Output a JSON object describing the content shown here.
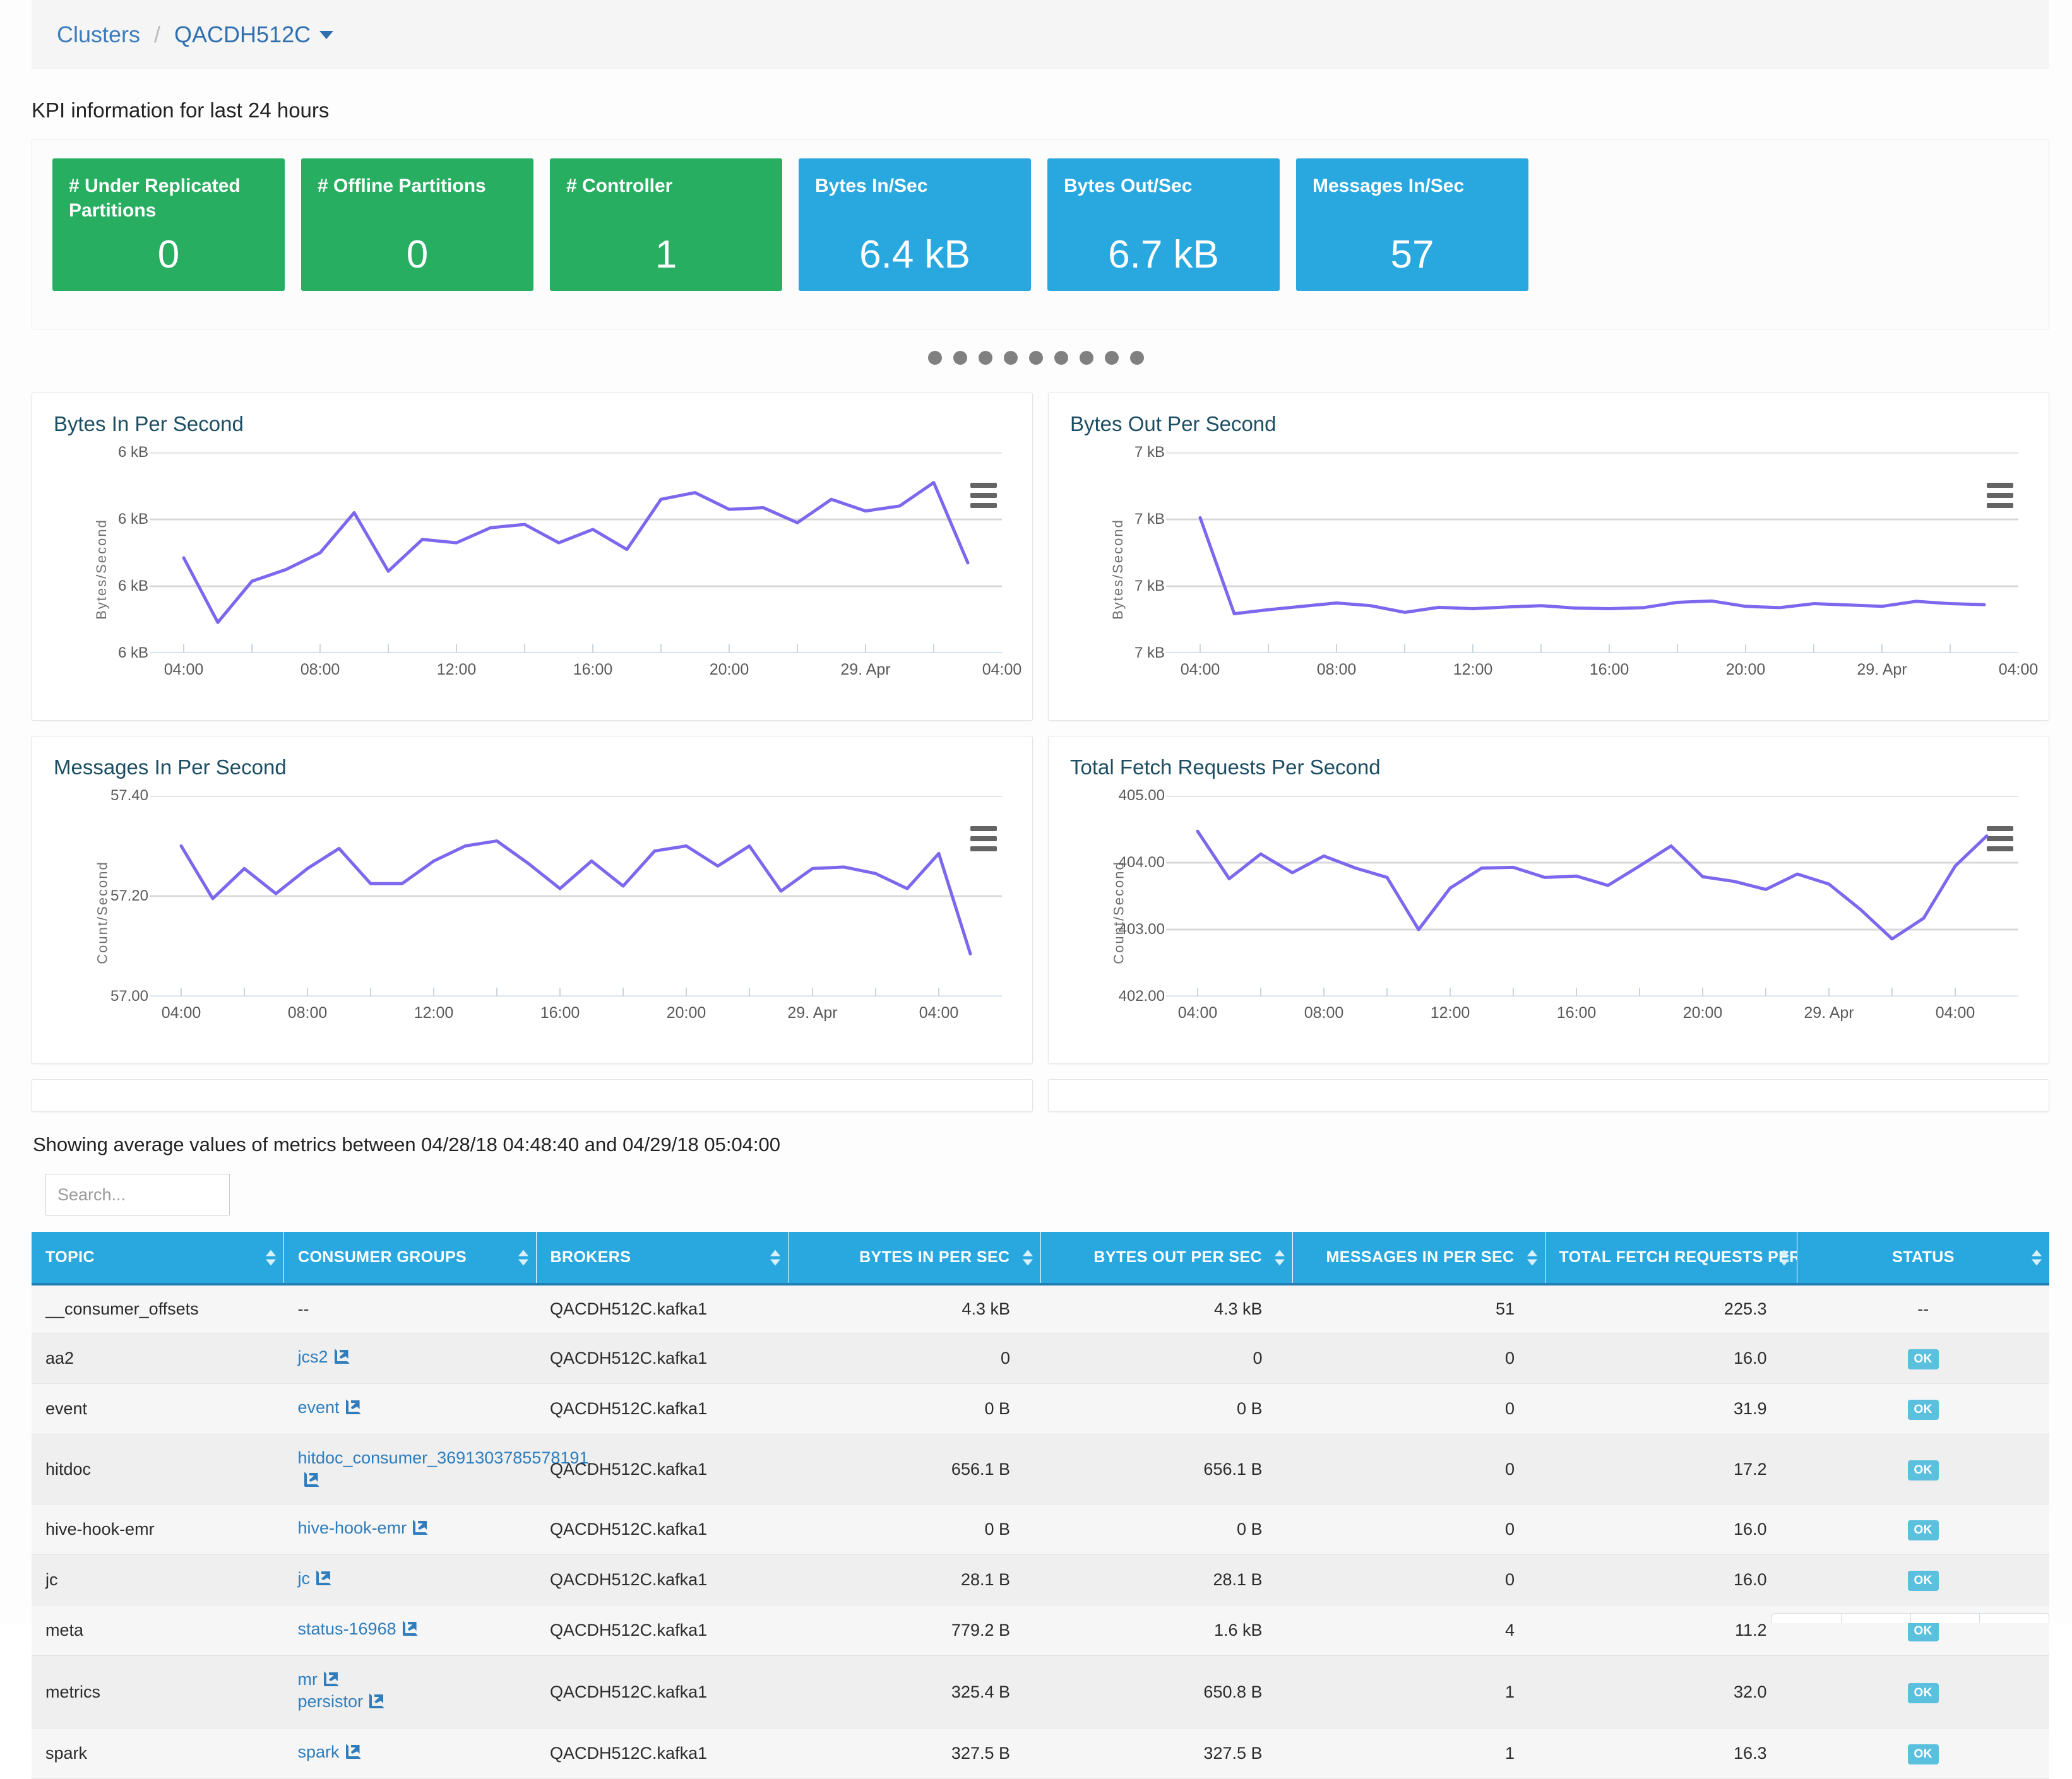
{
  "breadcrumb": {
    "root": "Clusters",
    "separator": "/",
    "current": "QACDH512C"
  },
  "kpi": {
    "heading": "KPI information for last 24 hours",
    "cards": [
      {
        "label": "# Under Replicated Partitions",
        "value": "0",
        "color": "#27ae60",
        "tone": "green"
      },
      {
        "label": "# Offline Partitions",
        "value": "0",
        "color": "#27ae60",
        "tone": "green"
      },
      {
        "label": "# Controller",
        "value": "1",
        "color": "#27ae60",
        "tone": "green"
      },
      {
        "label": "Bytes In/Sec",
        "value": "6.4 kB",
        "color": "#29a8e0",
        "tone": "blue"
      },
      {
        "label": "Bytes Out/Sec",
        "value": "6.7 kB",
        "color": "#29a8e0",
        "tone": "blue"
      },
      {
        "label": "Messages In/Sec",
        "value": "57",
        "color": "#29a8e0",
        "tone": "blue"
      }
    ],
    "carousel_dots": 9
  },
  "chart_data": [
    {
      "type": "line",
      "title": "Bytes In Per Second",
      "ylabel": "Bytes/Second",
      "xlabel": "",
      "yticks": [
        "6 kB",
        "6 kB",
        "6 kB",
        "6 kB"
      ],
      "ylim": [
        6000,
        6600
      ],
      "ytick_values": [
        6600,
        6400,
        6200,
        6000
      ],
      "xticks": [
        "04:00",
        "08:00",
        "12:00",
        "16:00",
        "20:00",
        "29. Apr",
        "04:00"
      ],
      "grid": true,
      "legend": "none",
      "color": "#7b68ee",
      "x": [
        0,
        1,
        2,
        3,
        4,
        5,
        6,
        7,
        8,
        9,
        10,
        11,
        12,
        13,
        14,
        15,
        16,
        17,
        18,
        19,
        20,
        21,
        22,
        23,
        24,
        25
      ],
      "values": [
        6285,
        6092,
        6215,
        6250,
        6300,
        6420,
        6245,
        6340,
        6330,
        6375,
        6385,
        6330,
        6370,
        6310,
        6460,
        6480,
        6430,
        6435,
        6390,
        6460,
        6425,
        6440,
        6510,
        6270
      ]
    },
    {
      "type": "line",
      "title": "Bytes Out Per Second",
      "ylabel": "Bytes/Second",
      "xlabel": "",
      "yticks": [
        "7 kB",
        "7 kB",
        "7 kB",
        "7 kB"
      ],
      "ylim": [
        6600,
        7200
      ],
      "ytick_values": [
        7200,
        7000,
        6800,
        6600
      ],
      "xticks": [
        "04:00",
        "08:00",
        "12:00",
        "16:00",
        "20:00",
        "29. Apr",
        "04:00"
      ],
      "grid": true,
      "legend": "none",
      "color": "#7b68ee",
      "x": [
        0,
        1,
        2,
        3,
        4,
        5,
        6,
        7,
        8,
        9,
        10,
        11,
        12,
        13,
        14,
        15,
        16,
        17,
        18,
        19,
        20,
        21,
        22,
        23
      ],
      "values": [
        7005,
        6718,
        6730,
        6740,
        6750,
        6742,
        6722,
        6737,
        6733,
        6738,
        6742,
        6735,
        6733,
        6736,
        6752,
        6756,
        6740,
        6736,
        6748,
        6744,
        6740,
        6755,
        6748,
        6745
      ]
    },
    {
      "type": "line",
      "title": "Messages In Per Second",
      "ylabel": "Count/Second",
      "xlabel": "",
      "yticks": [
        "57.40",
        "57.20",
        "57.00"
      ],
      "ylim": [
        57.0,
        57.4
      ],
      "ytick_values": [
        57.4,
        57.2,
        57.0
      ],
      "xticks": [
        "04:00",
        "08:00",
        "12:00",
        "16:00",
        "20:00",
        "29. Apr",
        "04:00"
      ],
      "grid": true,
      "legend": "none",
      "color": "#7b68ee",
      "x": [
        0,
        1,
        2,
        3,
        4,
        5,
        6,
        7,
        8,
        9,
        10,
        11,
        12,
        13,
        14,
        15,
        16,
        17,
        18,
        19,
        20,
        21,
        22,
        23,
        24,
        25
      ],
      "values": [
        57.3,
        57.195,
        57.255,
        57.205,
        57.255,
        57.295,
        57.225,
        57.225,
        57.27,
        57.3,
        57.31,
        57.265,
        57.215,
        57.27,
        57.22,
        57.29,
        57.3,
        57.26,
        57.3,
        57.21,
        57.255,
        57.258,
        57.245,
        57.215,
        57.285,
        57.085
      ]
    },
    {
      "type": "line",
      "title": "Total Fetch Requests Per Second",
      "ylabel": "Count/Second",
      "xlabel": "",
      "yticks": [
        "405.00",
        "404.00",
        "403.00",
        "402.00"
      ],
      "ylim": [
        402.0,
        405.0
      ],
      "ytick_values": [
        405.0,
        404.0,
        403.0,
        402.0
      ],
      "xticks": [
        "04:00",
        "08:00",
        "12:00",
        "16:00",
        "20:00",
        "29. Apr",
        "04:00"
      ],
      "grid": true,
      "legend": "none",
      "color": "#7b68ee",
      "x": [
        0,
        1,
        2,
        3,
        4,
        5,
        6,
        7,
        8,
        9,
        10,
        11,
        12,
        13,
        14,
        15,
        16,
        17,
        18,
        19,
        20,
        21,
        22,
        23,
        24,
        25
      ],
      "values": [
        404.47,
        403.76,
        404.13,
        403.85,
        404.1,
        403.92,
        403.78,
        403.0,
        403.62,
        403.92,
        403.93,
        403.78,
        403.8,
        403.66,
        403.95,
        404.25,
        403.79,
        403.72,
        403.6,
        403.83,
        403.68,
        403.3,
        402.86,
        403.17,
        403.95,
        404.4
      ]
    }
  ],
  "metrics_note": "Showing average values of metrics between 04/28/18 04:48:40 and 04/29/18 05:04:00",
  "search": {
    "placeholder": "Search...",
    "value": ""
  },
  "table": {
    "columns": [
      {
        "label": "TOPIC",
        "align": "left",
        "sortable": true
      },
      {
        "label": "CONSUMER GROUPS",
        "align": "left",
        "sortable": true
      },
      {
        "label": "BROKERS",
        "align": "left",
        "sortable": true
      },
      {
        "label": "BYTES IN PER SEC",
        "align": "right",
        "sortable": true
      },
      {
        "label": "BYTES OUT PER SEC",
        "align": "right",
        "sortable": true
      },
      {
        "label": "MESSAGES IN PER SEC",
        "align": "right",
        "sortable": true
      },
      {
        "label": "TOTAL FETCH REQUESTS PER SEC",
        "align": "right",
        "sortable": true
      },
      {
        "label": "STATUS",
        "align": "center",
        "sortable": true
      }
    ],
    "rows": [
      {
        "topic": "__consumer_offsets",
        "consumer_groups": [
          "--"
        ],
        "groups_are_links": false,
        "brokers": "QACDH512C.kafka1",
        "bytes_in": "4.3 kB",
        "bytes_out": "4.3 kB",
        "messages_in": "51",
        "fetch_requests": "225.3",
        "status": "--"
      },
      {
        "topic": "aa2",
        "consumer_groups": [
          "jcs2"
        ],
        "groups_are_links": true,
        "brokers": "QACDH512C.kafka1",
        "bytes_in": "0",
        "bytes_out": "0",
        "messages_in": "0",
        "fetch_requests": "16.0",
        "status": "OK"
      },
      {
        "topic": "event",
        "consumer_groups": [
          "event"
        ],
        "groups_are_links": true,
        "brokers": "QACDH512C.kafka1",
        "bytes_in": "0 B",
        "bytes_out": "0 B",
        "messages_in": "0",
        "fetch_requests": "31.9",
        "status": "OK"
      },
      {
        "topic": "hitdoc",
        "consumer_groups": [
          "hitdoc_consumer_3691303785578191"
        ],
        "groups_are_links": true,
        "brokers": "QACDH512C.kafka1",
        "bytes_in": "656.1 B",
        "bytes_out": "656.1 B",
        "messages_in": "0",
        "fetch_requests": "17.2",
        "status": "OK"
      },
      {
        "topic": "hive-hook-emr",
        "consumer_groups": [
          "hive-hook-emr"
        ],
        "groups_are_links": true,
        "brokers": "QACDH512C.kafka1",
        "bytes_in": "0 B",
        "bytes_out": "0 B",
        "messages_in": "0",
        "fetch_requests": "16.0",
        "status": "OK"
      },
      {
        "topic": "jc",
        "consumer_groups": [
          "jc"
        ],
        "groups_are_links": true,
        "brokers": "QACDH512C.kafka1",
        "bytes_in": "28.1 B",
        "bytes_out": "28.1 B",
        "messages_in": "0",
        "fetch_requests": "16.0",
        "status": "OK"
      },
      {
        "topic": "meta",
        "consumer_groups": [
          "status-16968"
        ],
        "groups_are_links": true,
        "brokers": "QACDH512C.kafka1",
        "bytes_in": "779.2 B",
        "bytes_out": "1.6 kB",
        "messages_in": "4",
        "fetch_requests": "11.2",
        "status": "OK"
      },
      {
        "topic": "metrics",
        "consumer_groups": [
          "mr",
          "persistor"
        ],
        "groups_are_links": true,
        "brokers": "QACDH512C.kafka1",
        "bytes_in": "325.4 B",
        "bytes_out": "650.8 B",
        "messages_in": "1",
        "fetch_requests": "32.0",
        "status": "OK"
      },
      {
        "topic": "spark",
        "consumer_groups": [
          "spark"
        ],
        "groups_are_links": true,
        "brokers": "QACDH512C.kafka1",
        "bytes_in": "327.5 B",
        "bytes_out": "327.5 B",
        "messages_in": "1",
        "fetch_requests": "16.3",
        "status": "OK"
      }
    ]
  },
  "colors": {
    "green": "#27ae60",
    "blue": "#29a8e0",
    "line": "#7b68ee",
    "link": "#2f7dbd",
    "header_rule": "#1f7fb5"
  }
}
